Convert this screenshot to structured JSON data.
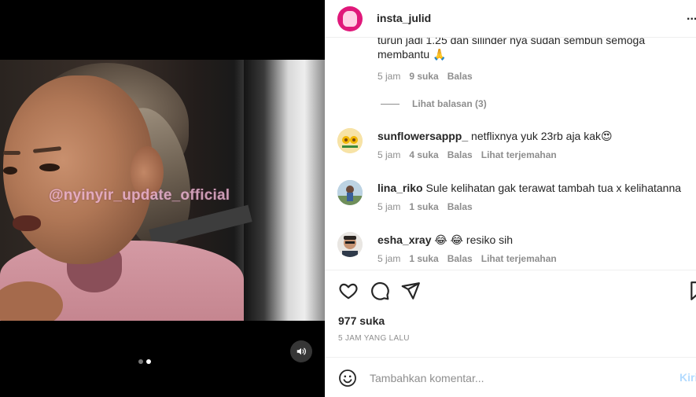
{
  "media": {
    "watermark": "@nyinyir_update_official",
    "carousel_active_index": 2,
    "carousel_count": 2,
    "mute_icon": "speaker-icon"
  },
  "header": {
    "username": "insta_julid",
    "more_label": "..."
  },
  "comments": {
    "partial": {
      "line1": "turun jadi 1.25 dan silinder nya sudah sembuh semoga",
      "line2": "membantu 🙏",
      "time": "5 jam",
      "likes": "9 suka",
      "reply": "Balas",
      "view_replies": "Lihat balasan (3)"
    },
    "items": [
      {
        "user": "sunflowersappp_",
        "text": "netflixnya yuk 23rb aja kak😍",
        "time": "5 jam",
        "likes": "4 suka",
        "reply": "Balas",
        "translate": "Lihat terjemahan"
      },
      {
        "user": "lina_riko",
        "text": "Sule kelihatan gak terawat tambah tua x kelihatanna",
        "time": "5 jam",
        "likes": "1 suka",
        "reply": "Balas"
      },
      {
        "user": "esha_xray",
        "text": "😂 😂  resiko sih",
        "time": "5 jam",
        "likes": "1 suka",
        "reply": "Balas",
        "translate": "Lihat terjemahan"
      }
    ]
  },
  "actions": {
    "like_icon": "heart-icon",
    "comment_icon": "comment-icon",
    "share_icon": "send-icon",
    "save_icon": "bookmark-icon",
    "likes": "977 suka",
    "posted": "5 JAM YANG LALU"
  },
  "add_comment": {
    "placeholder": "Tambahkan komentar...",
    "post_label": "Kirim",
    "emoji_icon": "smiley-icon"
  },
  "colors": {
    "accent": "#0095f6",
    "post_disabled": "#b3dbff",
    "muted_text": "#8e8e8e"
  }
}
